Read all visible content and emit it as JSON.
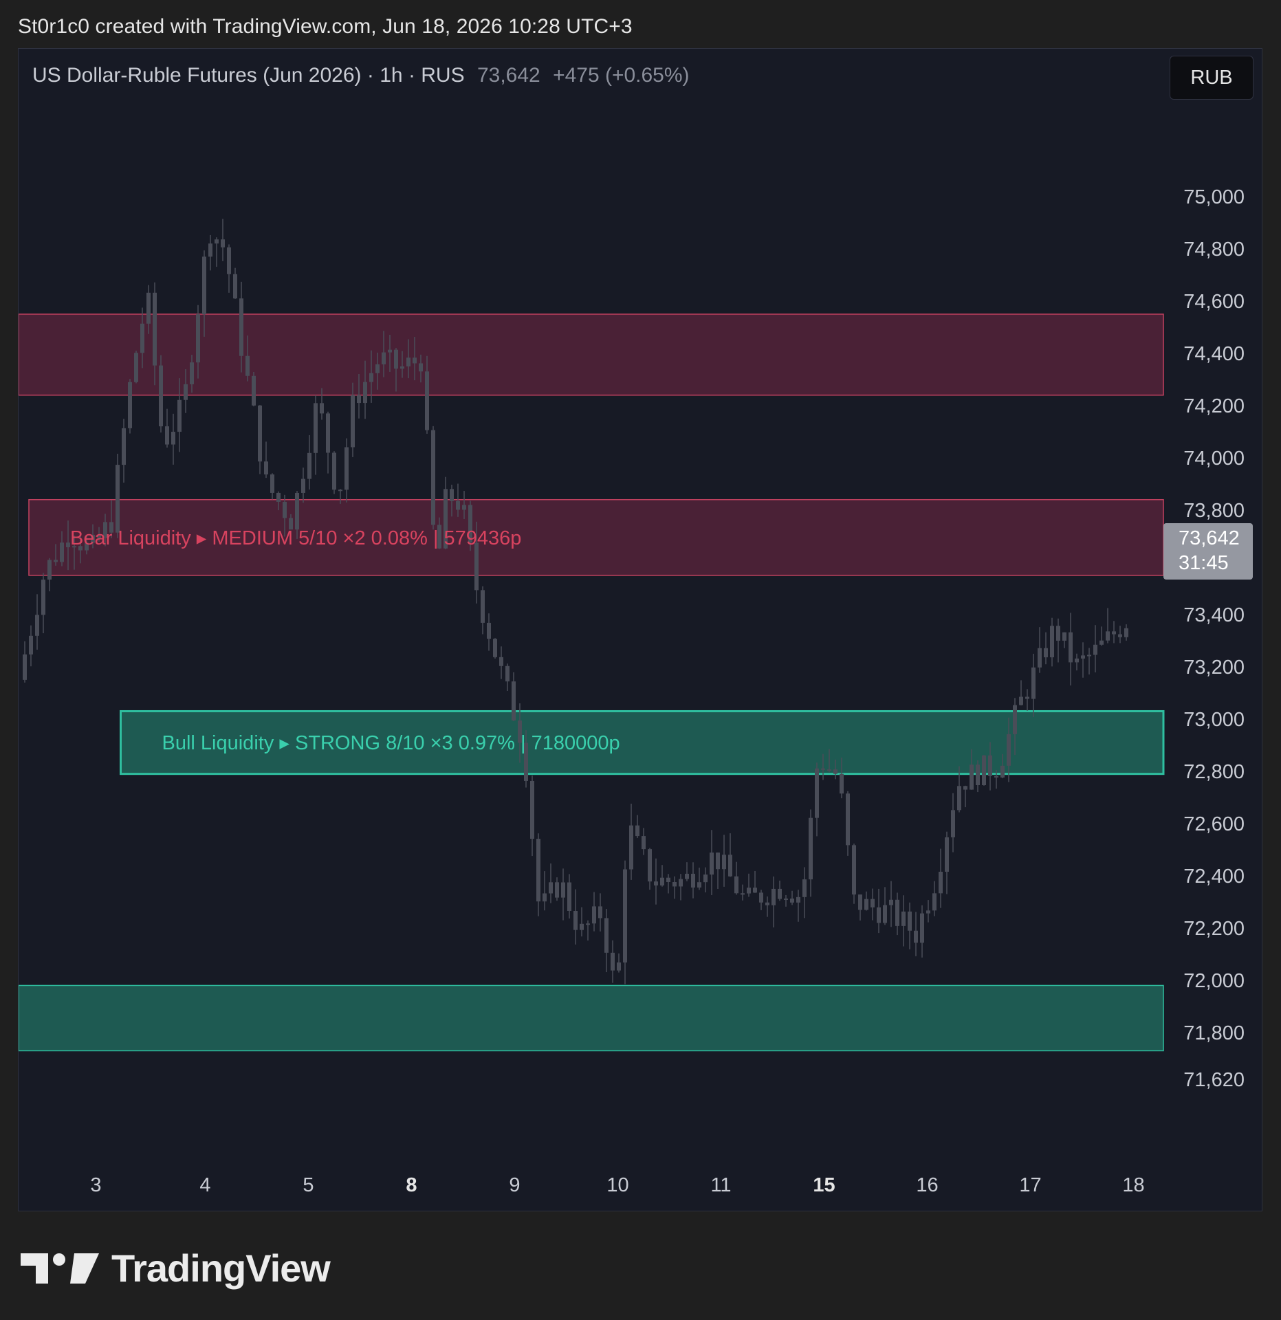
{
  "header": {
    "credit": "St0r1c0 created with TradingView.com, Jun 18, 2026 10:28 UTC+3"
  },
  "legend": {
    "instrument": "US Dollar-Ruble Futures (Jun 2026)",
    "interval": "1h",
    "exchange": "RUS",
    "last_price": "73,642",
    "change": "+475 (+0.65%)"
  },
  "currency_button": "RUB",
  "price_tag": {
    "price": "73,642",
    "countdown": "31:45"
  },
  "footer": {
    "brand": "TradingView"
  },
  "colors": {
    "background": "#171a25",
    "bear_zone_fill": "#4a2136",
    "bear_zone_border": "#c2415f",
    "bear_label": "#d8435f",
    "bull_zone_fill": "#1e5a52",
    "bull_zone_border": "#2fbfa0",
    "bull_label": "#3ad0ad",
    "candle": "#4a4d58",
    "axis_text": "#c9ccd4"
  },
  "chart_data": {
    "type": "candlestick",
    "title": "US Dollar-Ruble Futures (Jun 2026) · 1h · RUS",
    "y_ticks": [
      75000,
      74800,
      74600,
      74400,
      74200,
      74000,
      73800,
      73400,
      73200,
      73000,
      72800,
      72600,
      72400,
      72200,
      72000,
      71800,
      71620
    ],
    "y_tick_labels": [
      "75,000",
      "74,800",
      "74,600",
      "74,400",
      "74,200",
      "74,000",
      "73,800",
      "73,400",
      "73,200",
      "73,000",
      "72,800",
      "72,600",
      "72,400",
      "72,200",
      "72,000",
      "71,800",
      "71,620"
    ],
    "ylim": [
      71460,
      75250
    ],
    "x_ticks": [
      {
        "label": "3",
        "bold": false,
        "day_index": 0.6
      },
      {
        "label": "4",
        "bold": false,
        "day_index": 1.66
      },
      {
        "label": "5",
        "bold": false,
        "day_index": 2.66
      },
      {
        "label": "8",
        "bold": true,
        "day_index": 3.66
      },
      {
        "label": "9",
        "bold": false,
        "day_index": 4.66
      },
      {
        "label": "10",
        "bold": false,
        "day_index": 5.66
      },
      {
        "label": "11",
        "bold": false,
        "day_index": 6.66
      },
      {
        "label": "15",
        "bold": true,
        "day_index": 7.66
      },
      {
        "label": "16",
        "bold": false,
        "day_index": 8.66
      },
      {
        "label": "17",
        "bold": false,
        "day_index": 9.66
      },
      {
        "label": "18",
        "bold": false,
        "day_index": 10.66
      }
    ],
    "x_range_days": [
      -0.15,
      10.95
    ],
    "zones": [
      {
        "kind": "bear",
        "start_day": -0.15,
        "top": 74550,
        "bottom": 74240,
        "label": ""
      },
      {
        "kind": "bear",
        "start_day": -0.05,
        "top": 73840,
        "bottom": 73550,
        "label": "Bear Liquidity ▸ MEDIUM  5/10  ×2   0.08% | 579436p"
      },
      {
        "kind": "bull",
        "start_day": 0.84,
        "top": 73030,
        "bottom": 72790,
        "label": "Bull Liquidity ▸ STRONG  8/10  ×3   0.97% | 7180000p"
      },
      {
        "kind": "bull",
        "start_day": -0.15,
        "top": 71980,
        "bottom": 71730,
        "label": ""
      }
    ],
    "anchors": [
      [
        -0.15,
        73150
      ],
      [
        0.1,
        73560
      ],
      [
        0.35,
        73720
      ],
      [
        0.55,
        73640
      ],
      [
        0.75,
        73760
      ],
      [
        0.95,
        74330
      ],
      [
        1.1,
        74620
      ],
      [
        1.25,
        74050
      ],
      [
        1.45,
        74200
      ],
      [
        1.7,
        74880
      ],
      [
        1.85,
        74800
      ],
      [
        2.0,
        74450
      ],
      [
        2.25,
        73900
      ],
      [
        2.5,
        73760
      ],
      [
        2.75,
        74220
      ],
      [
        2.95,
        73850
      ],
      [
        3.1,
        74220
      ],
      [
        3.35,
        74380
      ],
      [
        3.55,
        74340
      ],
      [
        3.75,
        74380
      ],
      [
        3.9,
        73560
      ],
      [
        4.0,
        73860
      ],
      [
        4.15,
        73820
      ],
      [
        4.3,
        73480
      ],
      [
        4.55,
        73150
      ],
      [
        4.75,
        72900
      ],
      [
        4.9,
        72260
      ],
      [
        5.1,
        72380
      ],
      [
        5.3,
        72180
      ],
      [
        5.5,
        72260
      ],
      [
        5.65,
        71920
      ],
      [
        5.75,
        72600
      ],
      [
        6.0,
        72380
      ],
      [
        6.3,
        72380
      ],
      [
        6.6,
        72480
      ],
      [
        6.9,
        72300
      ],
      [
        7.25,
        72360
      ],
      [
        7.45,
        72320
      ],
      [
        7.6,
        72850
      ],
      [
        7.8,
        72780
      ],
      [
        7.95,
        72300
      ],
      [
        8.3,
        72260
      ],
      [
        8.55,
        72180
      ],
      [
        8.75,
        72400
      ],
      [
        8.95,
        72750
      ],
      [
        9.15,
        72800
      ],
      [
        9.35,
        72820
      ],
      [
        9.55,
        73050
      ],
      [
        9.75,
        73220
      ],
      [
        9.9,
        73350
      ],
      [
        10.1,
        73200
      ],
      [
        10.3,
        73260
      ],
      [
        10.6,
        73380
      ],
      [
        10.62,
        73642
      ]
    ]
  }
}
